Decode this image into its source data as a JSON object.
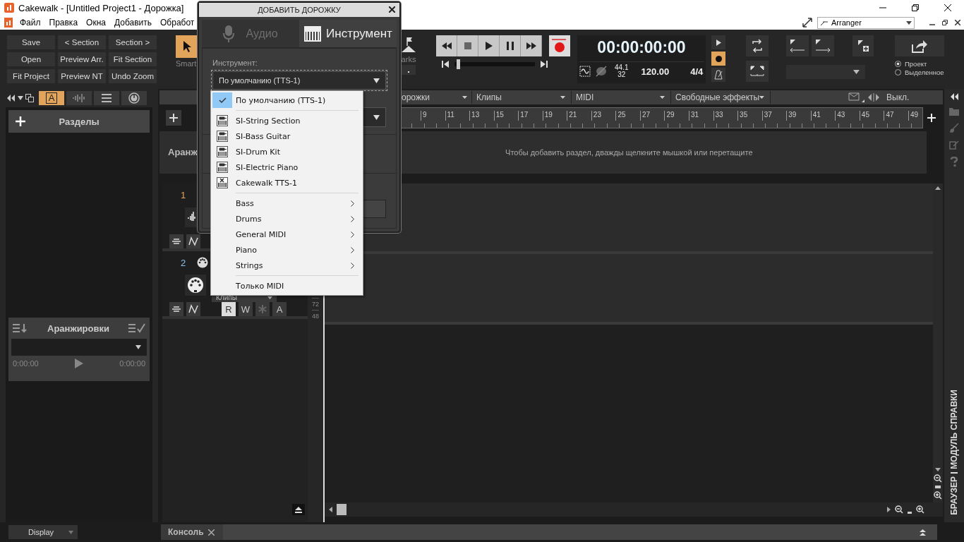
{
  "window": {
    "title": "Cakewalk - [Untitled Project1 - Дорожка]"
  },
  "menu": [
    "Файл",
    "Правка",
    "Окна",
    "Добавить",
    "Обработ"
  ],
  "workspace": {
    "value": "Arranger"
  },
  "control_bar": {
    "buttons": [
      "Save",
      "< Section",
      "Section >",
      "Open",
      "Preview Arr.",
      "Fit Section",
      "Fit Project",
      "Preview NT",
      "Undo Zoom"
    ],
    "tool": {
      "label": "Smart",
      "selected": true
    },
    "markers": {
      "label": "arks"
    },
    "scrub": {
      "level": 0.03
    },
    "time": "00:00:00:00",
    "sample_rate": "44.1",
    "bit_depth": "32",
    "tempo": "120.00",
    "meter": "4/4",
    "side_toggles": [
      {
        "kind": "play",
        "on": false
      },
      {
        "kind": "record",
        "on": true
      },
      {
        "kind": "metronome",
        "on": false
      }
    ],
    "export_scope": [
      {
        "label": "Проект",
        "selected": true
      },
      {
        "label": "Выделенное",
        "selected": false
      }
    ]
  },
  "left_panel": {
    "tabs": [
      {
        "kind": "letter",
        "label": "A",
        "selected": true
      },
      {
        "kind": "waveform",
        "selected": false
      },
      {
        "kind": "list",
        "selected": false
      },
      {
        "kind": "knob",
        "selected": false
      }
    ],
    "sections_title": "Разделы",
    "arrangements": {
      "title": "Аранжировки",
      "start": "0:00:00",
      "end": "0:00:00"
    },
    "display": "Display"
  },
  "track_view": {
    "menus": [
      "орожки",
      "Клипы",
      "MIDI",
      "Свободные эффекты"
    ],
    "snap": "Выкл.",
    "ruler": [
      "9",
      "11",
      "13",
      "15",
      "17",
      "19",
      "21",
      "23",
      "25",
      "27",
      "29",
      "31",
      "33",
      "35",
      "37",
      "39",
      "41",
      "43",
      "45",
      "47",
      "49"
    ],
    "arranger_label": "Аранж",
    "arranger_hint": "Чтобы добавить раздел, дважды щелкните мышкой или перетащите",
    "tracks": [
      {
        "number": "1",
        "kind": "audio",
        "selected": true
      },
      {
        "number": "2",
        "kind": "midi",
        "selected": false,
        "clips": "Клипы",
        "buttons": [
          {
            "kind": "letter",
            "label": "R",
            "on": true
          },
          {
            "kind": "letter",
            "label": "W",
            "on": false
          },
          {
            "kind": "asterisk",
            "on": false
          },
          {
            "kind": "letter",
            "label": "A",
            "on": false
          }
        ]
      }
    ],
    "velocity_labels": [
      "72",
      "48"
    ]
  },
  "dialog": {
    "title": "ДОБАВИТЬ ДОРОЖКУ",
    "tabs": [
      {
        "kind": "audio",
        "label": "Аудио",
        "selected": false
      },
      {
        "kind": "instrument",
        "label": "Инструмент",
        "selected": true
      }
    ],
    "field_label": "Инструмент:",
    "instrument": "По умолчанию (TTS-1)",
    "menu_groups": [
      {
        "items": [
          {
            "label": "По умолчанию (TTS-1)",
            "kind": "plain",
            "selected": true
          }
        ]
      },
      {
        "items": [
          {
            "label": "SI-String Section",
            "kind": "synth",
            "selected": false
          },
          {
            "label": "SI-Bass Guitar",
            "kind": "synth",
            "selected": false
          },
          {
            "label": "SI-Drum Kit",
            "kind": "synth",
            "selected": false
          },
          {
            "label": "SI-Electric Piano",
            "kind": "synth",
            "selected": false
          },
          {
            "label": "Cakewalk TTS-1",
            "kind": "tts",
            "selected": false
          }
        ]
      },
      {
        "items": [
          {
            "label": "Bass",
            "kind": "submenu",
            "selected": false
          },
          {
            "label": "Drums",
            "kind": "submenu",
            "selected": false
          },
          {
            "label": "General MIDI",
            "kind": "submenu",
            "selected": false
          },
          {
            "label": "Piano",
            "kind": "submenu",
            "selected": false
          },
          {
            "label": "Strings",
            "kind": "submenu",
            "selected": false
          }
        ]
      },
      {
        "items": [
          {
            "label": "Только MIDI",
            "kind": "plain",
            "selected": false
          }
        ]
      }
    ]
  },
  "side_strip": [
    "БРАУЗЕР",
    "МОДУЛЬ СПРАВКИ"
  ],
  "console": {
    "label": "Консоль"
  }
}
